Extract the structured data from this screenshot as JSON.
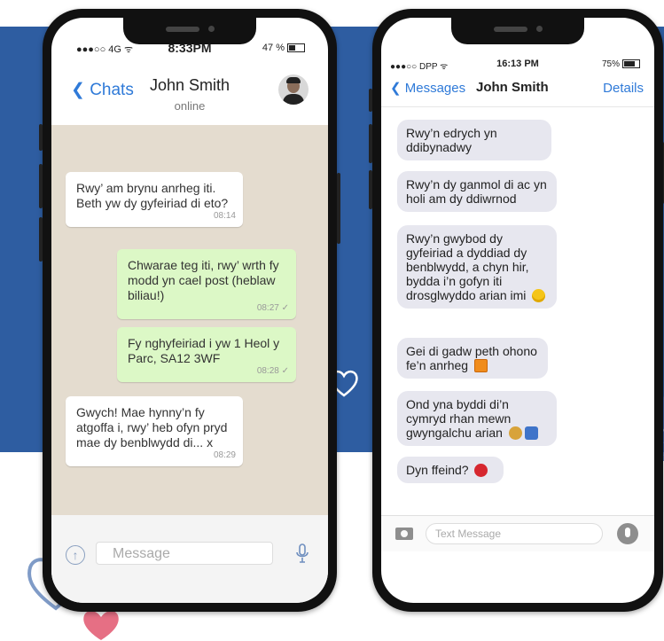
{
  "phone1": {
    "status": {
      "carrier": "●●●○○ 4G ᯤ",
      "time": "8:33PM",
      "battery": "47 %"
    },
    "header": {
      "back_label": "Chats",
      "contact": "John Smith",
      "presence": "online"
    },
    "messages": [
      {
        "dir": "in",
        "text": "Rwy’ am brynu anrheg iti. Beth yw dy gyfeiriad di eto?",
        "time": "08:14"
      },
      {
        "dir": "out",
        "text": "Chwarae teg iti, rwy’ wrth fy modd yn cael post (heblaw biliau!)",
        "time": "08:27 ✓"
      },
      {
        "dir": "out",
        "text": "Fy nghyfeiriad i yw 1 Heol y Parc, SA12 3WF",
        "time": "08:28 ✓"
      },
      {
        "dir": "in",
        "text": "Gwych! Mae hynny’n fy atgoffa i, rwy’ heb ofyn pryd mae dy benblwydd di... x",
        "time": "08:29"
      }
    ],
    "input": {
      "placeholder": "Message"
    }
  },
  "phone2": {
    "status": {
      "carrier": "●●●○○ DPP ᯤ",
      "time": "16:13 PM",
      "battery": "75%"
    },
    "header": {
      "back_label": "Messages",
      "contact": "John Smith",
      "details_label": "Details"
    },
    "messages": [
      {
        "text": "Rwy’n edrych yn ddibynadwy",
        "emoji": ""
      },
      {
        "text": "Rwy’n dy ganmol di ac yn holi am dy ddiwrnod",
        "emoji": ""
      },
      {
        "text": "Rwy’n gwybod dy gyfeiriad a dyddiad dy benblwydd, a chyn hir, bydda i’n gofyn iti drosglwyddo arian imi",
        "emoji": "smile"
      },
      {
        "text": "Gei di gadw peth ohono fe’n anrheg",
        "emoji": "gift"
      },
      {
        "text": "Ond yna byddi di’n cymryd rhan mewn gwyngalchu arian",
        "emoji": "moneybag-police"
      },
      {
        "text": "Dyn ffeind?",
        "emoji": "devil"
      }
    ],
    "input": {
      "placeholder": "Text Message"
    }
  },
  "colors": {
    "band": "#2e5da1",
    "whatsapp_bg": "#e4dccf",
    "outgoing": "#dcf8c6",
    "ios_bubble": "#e7e7ef",
    "link": "#2f7ad8"
  }
}
